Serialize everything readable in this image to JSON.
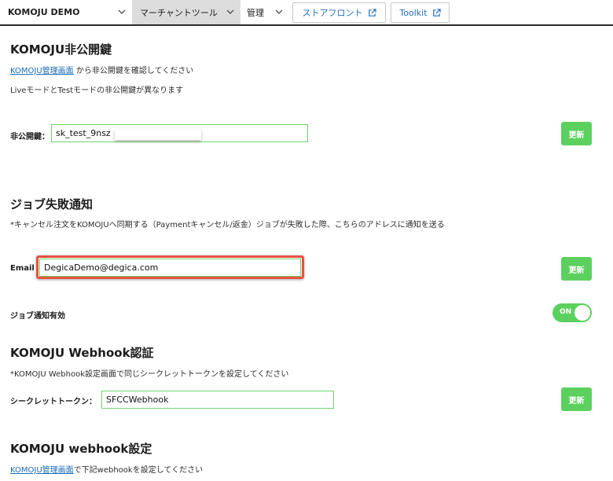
{
  "topbar": {
    "store_name": "KOMOJU DEMO",
    "merchant_tools": "マーチャントツール",
    "admin": "管理",
    "storefront": "ストアフロント",
    "toolkit": "Toolkit"
  },
  "private_key": {
    "heading": "KOMOJU非公開鍵",
    "link": "KOMOJU管理画面",
    "desc_suffix": " から非公開鍵を確認してください",
    "note": "LiveモードとTestモードの非公開鍵が異なります",
    "label": "非公開鍵：",
    "value": "sk_test_9nsz",
    "update": "更新"
  },
  "job_notify": {
    "heading": "ジョブ失敗通知",
    "desc": "*キャンセル注文をKOMOJUへ同期する（Paymentキャンセル/返金）ジョブが失敗した際、こちらのアドレスに通知を送る",
    "email_label": "Email",
    "email_value": "DegicaDemo@degica.com",
    "update": "更新",
    "enabled_label": "ジョブ通知有効",
    "toggle": "ON"
  },
  "webhook_auth": {
    "heading": "KOMOJU Webhook認証",
    "desc": "*KOMOJU Webhook設定画面で同じシークレットトークンを設定してください",
    "label": "シークレットトークン：",
    "value": "SFCCWebhook",
    "update": "更新"
  },
  "webhook_settings": {
    "heading": "KOMOJU webhook設定",
    "link": "KOMOJU管理画面",
    "desc_suffix": "で下記webhookを設定してください"
  },
  "colors": {
    "accent_green": "#5cd05e",
    "link_blue": "#1a6ab3",
    "highlight_red": "#e8523f"
  }
}
